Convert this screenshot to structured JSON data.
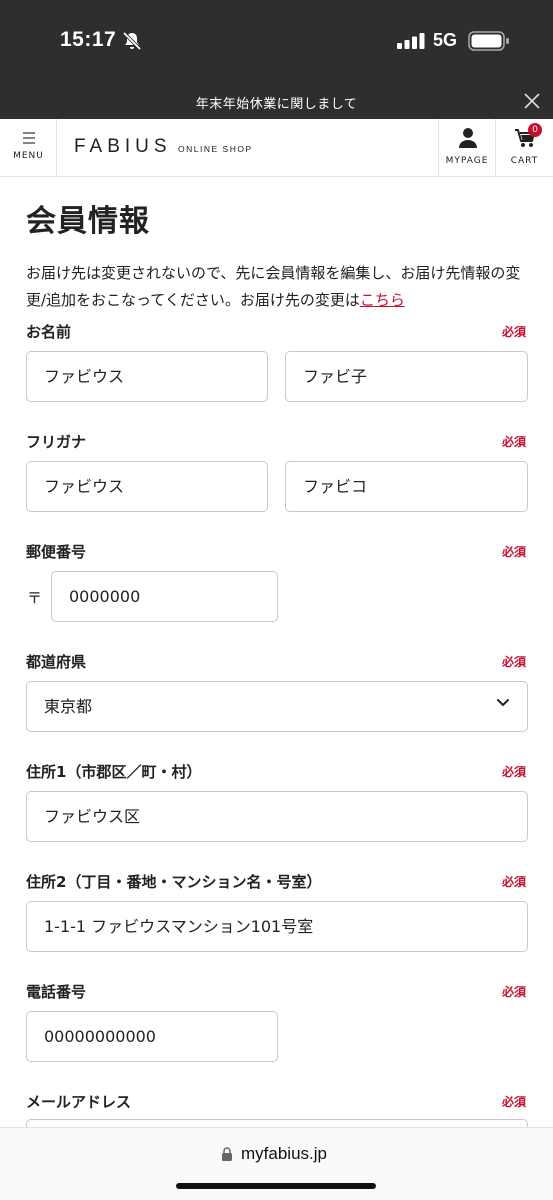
{
  "status_bar": {
    "time": "15:17",
    "network": "5G"
  },
  "banner": {
    "text": "年末年始休業に関しまして"
  },
  "header": {
    "menu_label": "MENU",
    "logo_main": "FABIUS",
    "logo_sub": "ONLINE SHOP",
    "mypage_label": "MYPAGE",
    "cart_label": "CART",
    "cart_count": "0"
  },
  "page": {
    "title": "会員情報",
    "intro": "お届け先は変更されないので、先に会員情報を編集し、お届け先情報の変更/追加をおこなってください。お届け先の変更は",
    "intro_link": "こちら",
    "required_label": "必須"
  },
  "form": {
    "name": {
      "label": "お名前",
      "last": "ファビウス",
      "first": "ファビ子"
    },
    "kana": {
      "label": "フリガナ",
      "last": "ファビウス",
      "first": "ファビコ"
    },
    "zip": {
      "label": "郵便番号",
      "mark": "〒",
      "value": "0000000"
    },
    "prefecture": {
      "label": "都道府県",
      "value": "東京都"
    },
    "address1": {
      "label": "住所1（市郡区／町・村）",
      "value": "ファビウス区"
    },
    "address2": {
      "label": "住所2（丁目・番地・マンション名・号室）",
      "value": "1-1-1 ファビウスマンション101号室"
    },
    "phone": {
      "label": "電話番号",
      "value": "00000000000"
    },
    "email": {
      "label": "メールアドレス",
      "value": ""
    }
  },
  "url_bar": {
    "url": "myfabius.jp"
  }
}
